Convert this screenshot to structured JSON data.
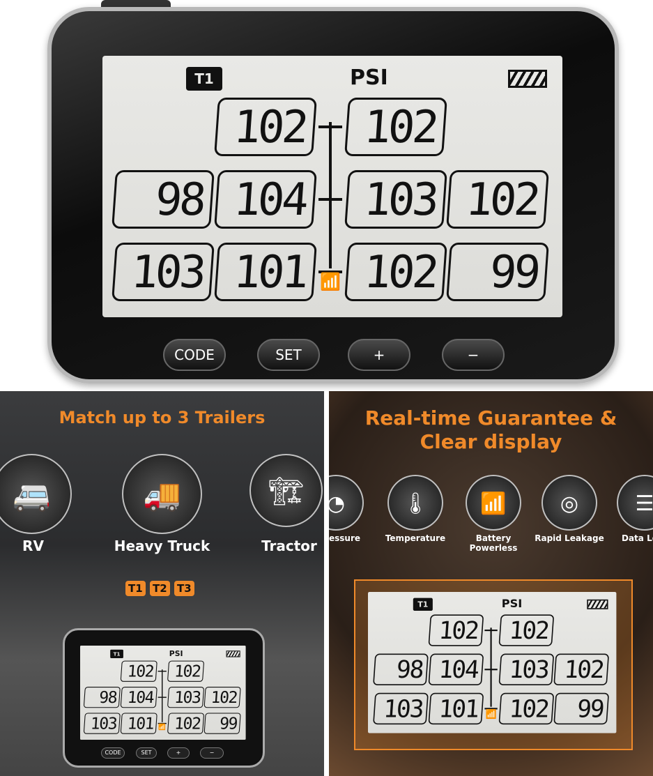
{
  "device": {
    "unit": "PSI",
    "trailer_badge": "T1",
    "battery_icon": "battery-full-icon",
    "signal_icon": "wifi-signal-icon",
    "readings": [
      [
        null,
        "102",
        "102",
        null
      ],
      [
        "98",
        "104",
        "103",
        "102"
      ],
      [
        "103",
        "101",
        "102",
        "99"
      ]
    ],
    "buttons": [
      "CODE",
      "SET",
      "+",
      "−"
    ]
  },
  "left_panel": {
    "title": "Match up to 3 Trailers",
    "vehicles": [
      {
        "label": "RV",
        "icon": "rv-icon"
      },
      {
        "label": "Heavy Truck",
        "icon": "truck-icon"
      },
      {
        "label": "Tractor",
        "icon": "tow-truck-icon"
      }
    ],
    "trailer_tags": [
      "T1",
      "T2",
      "T3"
    ]
  },
  "right_panel": {
    "title_line1": "Real-time Guarantee &",
    "title_line2": "Clear display",
    "accent": "#f08a2a",
    "features": [
      {
        "label": "essure",
        "icon": "gauge-icon"
      },
      {
        "label": "Temperature",
        "icon": "thermometer-icon"
      },
      {
        "label": "Battery Powerless",
        "icon": "battery-signal-icon"
      },
      {
        "label": "Rapid Leakage",
        "icon": "tire-leak-icon"
      },
      {
        "label": "Data Lo",
        "icon": "data-layers-icon"
      }
    ]
  }
}
